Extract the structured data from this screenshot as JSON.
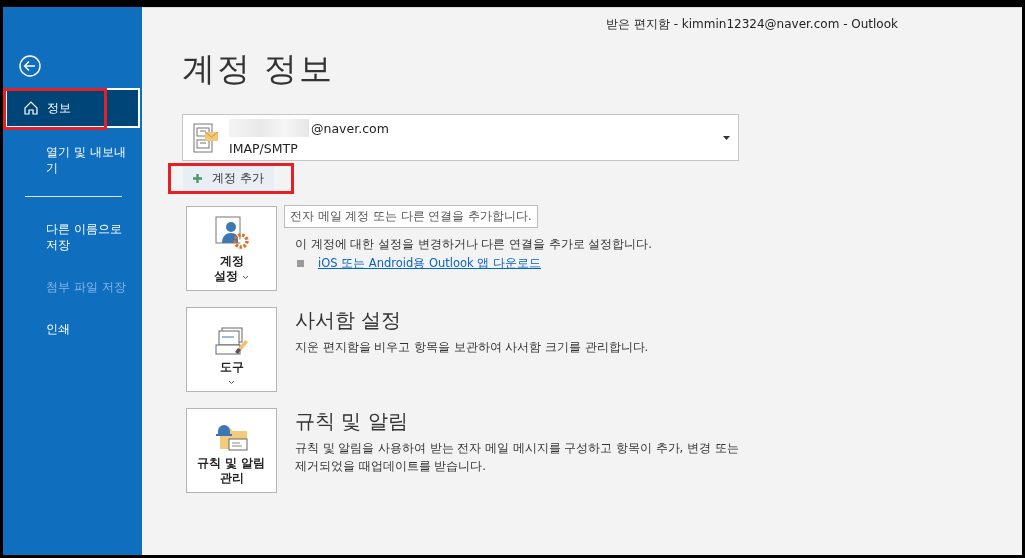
{
  "window": {
    "title": "받은 편지함 - kimmin12324@naver.com  -  Outlook"
  },
  "sidebar": {
    "items": [
      {
        "label": "정보",
        "selected": true,
        "disabled": false,
        "highlighted": true
      },
      {
        "label": "열기 및 내보내기",
        "selected": false,
        "disabled": false,
        "highlighted": false
      },
      {
        "label": "다른 이름으로 저장",
        "selected": false,
        "disabled": false,
        "highlighted": false
      },
      {
        "label": "첨부 파일 저장",
        "selected": false,
        "disabled": true,
        "highlighted": false
      },
      {
        "label": "인쇄",
        "selected": false,
        "disabled": false,
        "highlighted": false
      }
    ]
  },
  "page": {
    "heading": "계정 정보",
    "account": {
      "email": "@naver.com",
      "type": "IMAP/SMTP"
    },
    "add_account": {
      "label": "계정 추가",
      "highlighted": true
    },
    "tooltip": "전자 메일 계정 또는 다른 연결을 추가합니다.",
    "sections": [
      {
        "kind": "account",
        "tile_label": [
          "계정",
          "설정"
        ],
        "has_menu": true,
        "description": "이 계정에 대한 설정을 변경하거나 다른 연결을 추가로 설정합니다.",
        "link": "iOS 또는 Android용 Outlook 앱 다운로드"
      },
      {
        "kind": "tools",
        "tile_label": [
          "도구"
        ],
        "has_menu": true,
        "heading": "사서함 설정",
        "description": "지운 편지함을 비우고 항목을 보관하여 사서함 크기를 관리합니다."
      },
      {
        "kind": "rules",
        "tile_label": [
          "규칙 및 알림",
          "관리"
        ],
        "has_menu": false,
        "heading": "규칙 및 알림",
        "description": "규칙 및 알림을 사용하여 받는 전자 메일 메시지를 구성하고 항목이 추가, 변경 또는 제거되었을 때업데이트를 받습니다."
      }
    ]
  }
}
